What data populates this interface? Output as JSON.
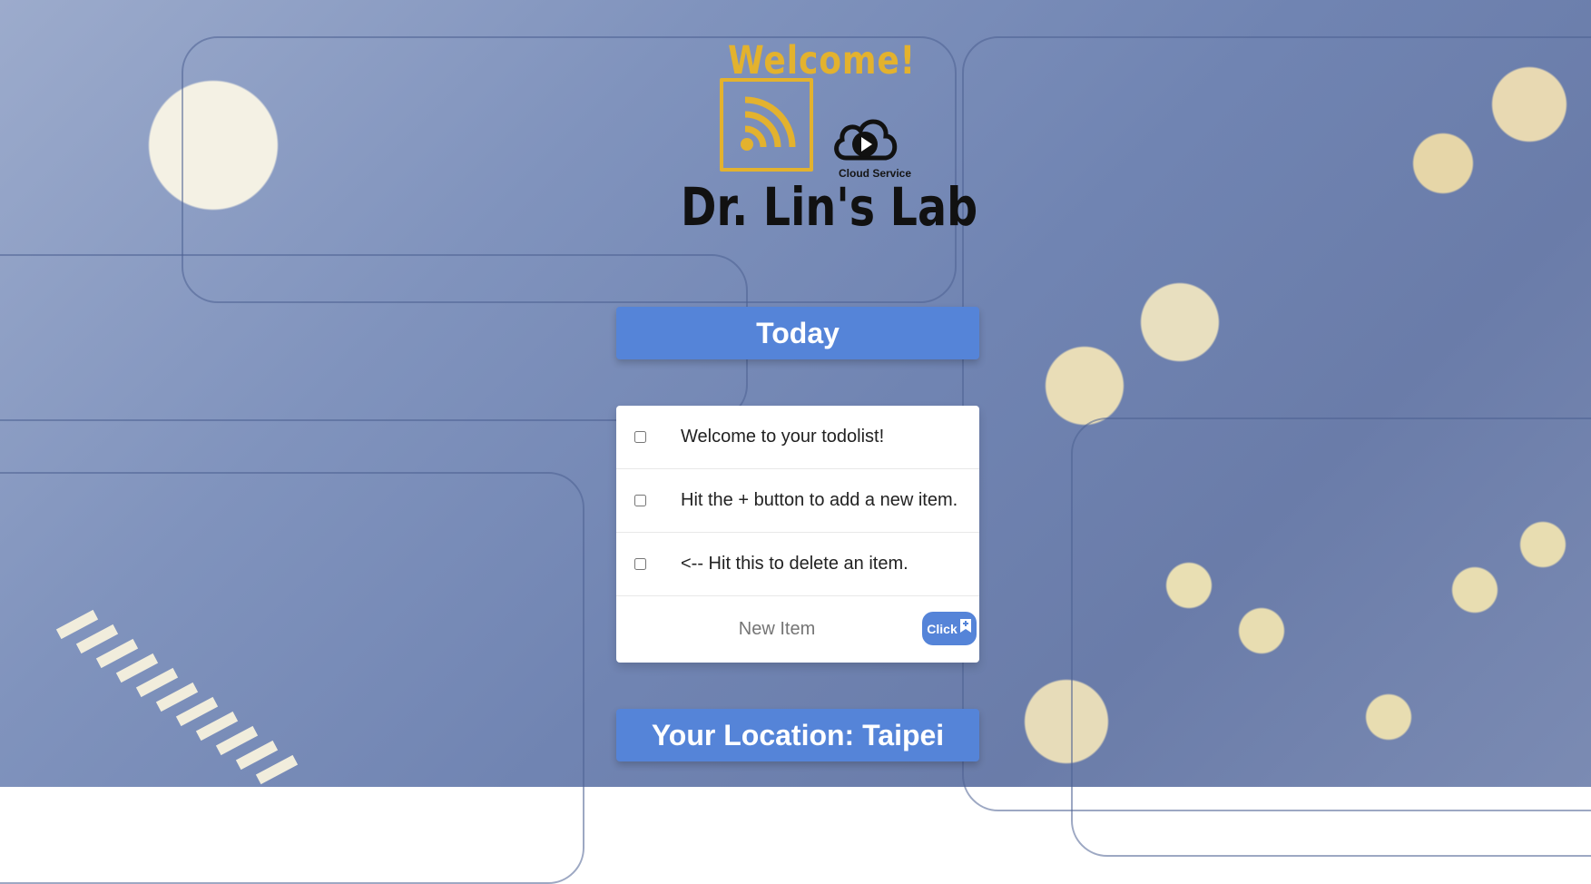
{
  "brand": {
    "welcome": "Welcome!",
    "cloud_label": "Cloud Service",
    "lab_name": "Dr. Lin's Lab",
    "accent_color": "#e3b22e"
  },
  "list": {
    "title": "Today",
    "items": [
      {
        "label": "Welcome to your todolist!",
        "checked": false
      },
      {
        "label": "Hit the + button to add a new item.",
        "checked": false
      },
      {
        "label": "<-- Hit this to delete an item.",
        "checked": false
      }
    ],
    "new_item_placeholder": "New Item",
    "add_button_label": "Click"
  },
  "location": {
    "label": "Your Location: Taipei"
  },
  "colors": {
    "button": "#5584d8",
    "card": "#ffffff"
  }
}
